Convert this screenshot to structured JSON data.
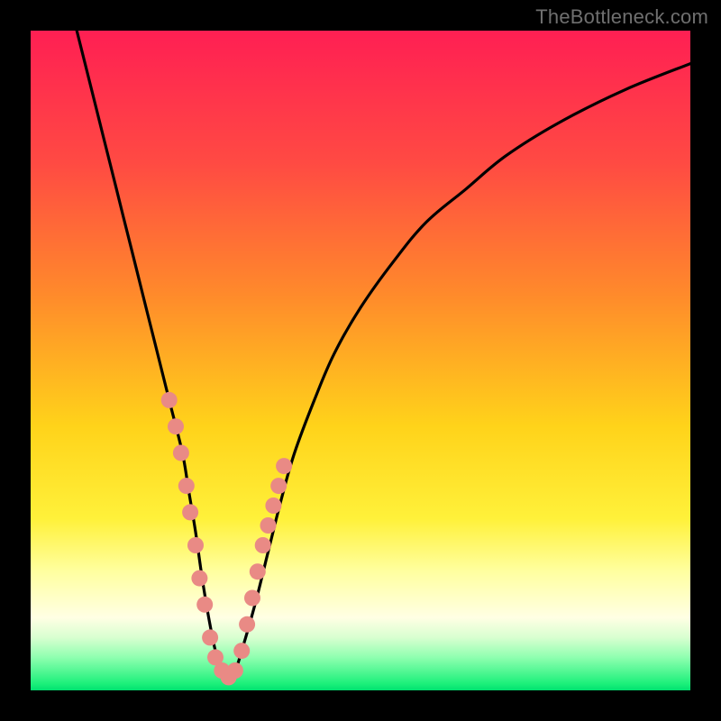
{
  "watermark": "TheBottleneck.com",
  "colors": {
    "gradient_stops": [
      {
        "c": "#ff1f53",
        "p": 0
      },
      {
        "c": "#ff4a43",
        "p": 20
      },
      {
        "c": "#ff8a2b",
        "p": 40
      },
      {
        "c": "#ffd31a",
        "p": 60
      },
      {
        "c": "#fff13a",
        "p": 74
      },
      {
        "c": "#ffffa0",
        "p": 82
      },
      {
        "c": "#ffffe4",
        "p": 89
      },
      {
        "c": "#d8ffd0",
        "p": 92
      },
      {
        "c": "#8fffb0",
        "p": 95
      },
      {
        "c": "#1cf07a",
        "p": 99
      },
      {
        "c": "#00e070",
        "p": 100
      }
    ],
    "curve": "#000000",
    "marker": "#e98a85"
  },
  "chart_data": {
    "type": "line",
    "title": "",
    "xlabel": "",
    "ylabel": "",
    "xlim": [
      0,
      100
    ],
    "ylim": [
      0,
      100
    ],
    "grid": false,
    "legend": false,
    "series": [
      {
        "name": "bottleneck-curve",
        "x": [
          7,
          9,
          11,
          13,
          15,
          17,
          19,
          21,
          23,
          24,
          25,
          26,
          27,
          28,
          29,
          30,
          31,
          32,
          34,
          36,
          38,
          40,
          43,
          46,
          50,
          55,
          60,
          66,
          72,
          80,
          90,
          100
        ],
        "y": [
          100,
          92,
          84,
          76,
          68,
          60,
          52,
          44,
          36,
          30,
          24,
          17,
          11,
          6,
          3,
          2,
          3,
          6,
          13,
          21,
          29,
          36,
          44,
          51,
          58,
          65,
          71,
          76,
          81,
          86,
          91,
          95
        ]
      }
    ],
    "markers": {
      "name": "highlight-points",
      "x": [
        21.0,
        22.0,
        22.8,
        23.6,
        24.2,
        25.0,
        25.6,
        26.4,
        27.2,
        28.0,
        29.0,
        30.0,
        31.0,
        32.0,
        32.8,
        33.6,
        34.4,
        35.2,
        36.0,
        36.8,
        37.6,
        38.4
      ],
      "y": [
        44,
        40,
        36,
        31,
        27,
        22,
        17,
        13,
        8,
        5,
        3,
        2,
        3,
        6,
        10,
        14,
        18,
        22,
        25,
        28,
        31,
        34
      ]
    },
    "trough_x": 30
  }
}
